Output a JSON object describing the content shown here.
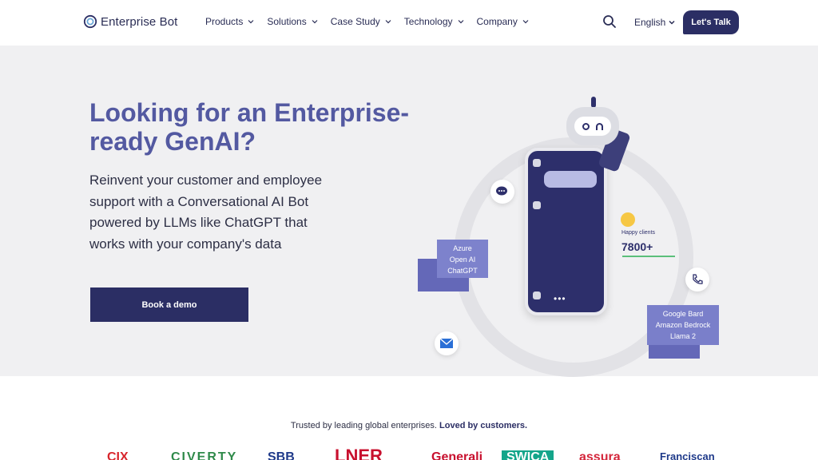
{
  "brand": {
    "name": "Enterprise Bot"
  },
  "nav": {
    "items": [
      {
        "label": "Products"
      },
      {
        "label": "Solutions"
      },
      {
        "label": "Case Study"
      },
      {
        "label": "Technology"
      },
      {
        "label": "Company"
      }
    ],
    "language": "English",
    "cta": "Let's Talk"
  },
  "hero": {
    "title": "Looking for an Enterprise-ready GenAI?",
    "subtitle": "Reinvent your customer and employee support with a Conversational AI Bot powered by LLMs like ChatGPT that works with your company's data",
    "cta": "Book a demo"
  },
  "illustration": {
    "left_card": [
      "Azure",
      "Open AI",
      "ChatGPT"
    ],
    "right_card": [
      "Google Bard",
      "Amazon Bedrock",
      "Llama 2"
    ],
    "happy_label": "Happy clients",
    "happy_count": "7800+"
  },
  "trusted": {
    "text": "Trusted by leading global enterprises.",
    "emphasis": "Loved by customers."
  },
  "logos": [
    "CIX",
    "CIVERTY",
    "SBB",
    "LNER",
    "Generali",
    "SWICA",
    "assura",
    "Franciscan"
  ],
  "colors": {
    "brand": "#2b2e64",
    "accent": "#5359a1",
    "hero_bg": "#f0f0f2"
  }
}
